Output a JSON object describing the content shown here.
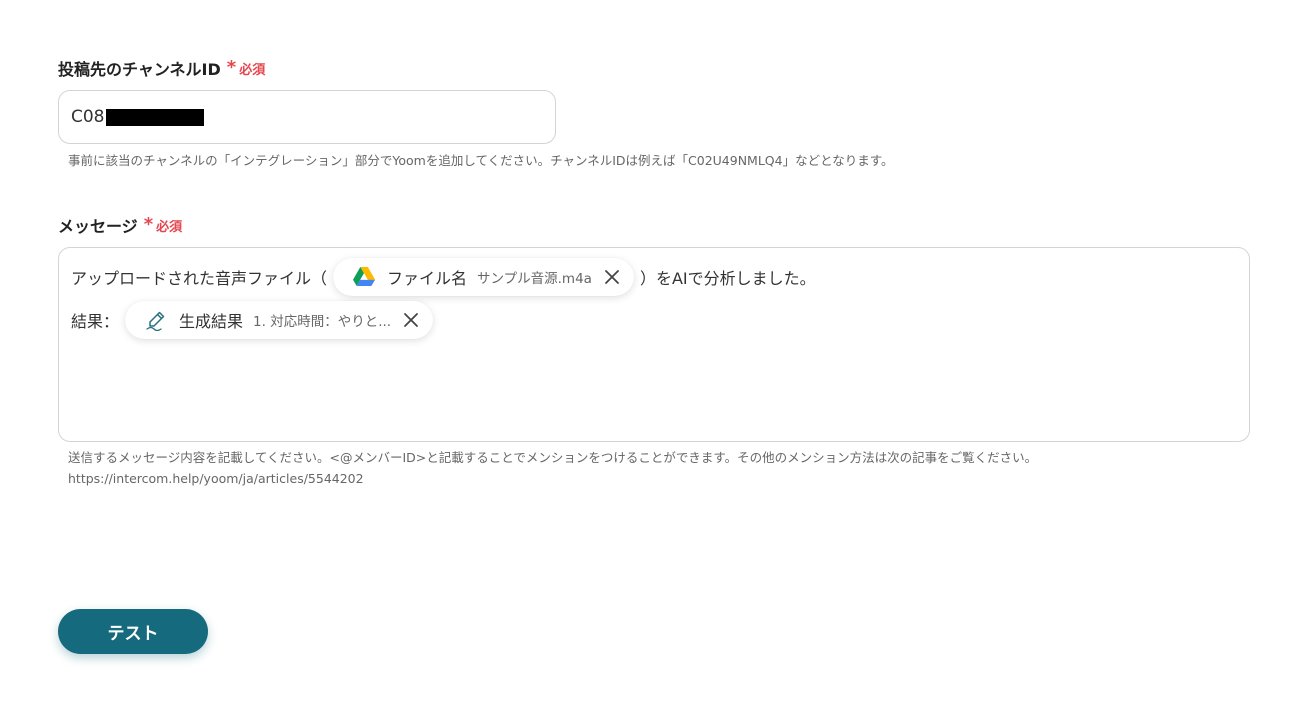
{
  "channel_field": {
    "label": "投稿先のチャンネルID",
    "required_mark": "*",
    "required_text": "必須",
    "value": "C08",
    "help_text": "事前に該当のチャンネルの「インテグレーション」部分でYoomを追加してください。チャンネルIDは例えば「C02U49NMLQ4」などとなります。"
  },
  "message_field": {
    "label": "メッセージ",
    "required_mark": "*",
    "required_text": "必須",
    "line1_prefix": "アップロードされた音声ファイル（",
    "line1_suffix": "）をAIで分析しました。",
    "line2_prefix": "結果：",
    "chips": [
      {
        "icon": "google-drive-icon",
        "name": "ファイル名",
        "value": "サンプル音源.m4a"
      },
      {
        "icon": "ai-pen-icon",
        "name": "生成結果",
        "value": "1. 対応時間：やりと..."
      }
    ],
    "help_line1": "送信するメッセージ内容を記載してください。<@メンバーID>と記載することでメンションをつけることができます。その他のメンション方法は次の記事をご覧ください。",
    "help_line2": "https://intercom.help/yoom/ja/articles/5544202"
  },
  "test_button": {
    "label": "テスト"
  },
  "colors": {
    "required": "#e5474f",
    "button": "#166a7d",
    "border": "#d4d4d8"
  }
}
